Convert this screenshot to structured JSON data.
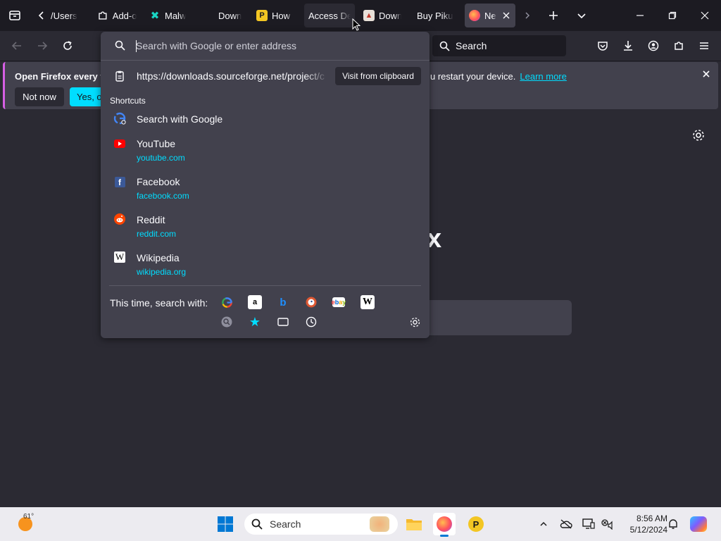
{
  "tabs": [
    {
      "label": "/Users",
      "icon": "chevron-left-icon"
    },
    {
      "label": "Add-o",
      "icon": "puzzle-icon"
    },
    {
      "label": "Malw",
      "icon": "malwarebytes-icon"
    },
    {
      "label": "Down",
      "icon": "none"
    },
    {
      "label": "How t",
      "icon": "plex-icon"
    },
    {
      "label": "Access De",
      "icon": "none"
    },
    {
      "label": "Down",
      "icon": "app-icon"
    },
    {
      "label": "Buy Pikun",
      "icon": "none"
    },
    {
      "label": "Ne",
      "icon": "firefox-icon"
    }
  ],
  "navbar": {
    "search_placeholder": "Search"
  },
  "notification": {
    "message": "Open Firefox every tir",
    "message_tail": "u restart your device.",
    "learn_more": "Learn more",
    "not_now": "Not now",
    "yes": "Yes, o"
  },
  "urlbar": {
    "placeholder": "Search with Google or enter address",
    "clipboard_url": "https://downloads.sourceforge.net/project/c",
    "clipboard_button": "Visit from clipboard",
    "shortcuts_label": "Shortcuts",
    "results": [
      {
        "title": "Search with Google",
        "url": "",
        "icon": "google-icon"
      },
      {
        "title": "YouTube",
        "url": "youtube.com",
        "icon": "youtube-icon"
      },
      {
        "title": "Facebook",
        "url": "facebook.com",
        "icon": "facebook-icon"
      },
      {
        "title": "Reddit",
        "url": "reddit.com",
        "icon": "reddit-icon"
      },
      {
        "title": "Wikipedia",
        "url": "wikipedia.org",
        "icon": "wikipedia-icon"
      }
    ],
    "oneoff_label": "This time, search with:",
    "oneoff_engines": [
      "google-icon",
      "amazon-icon",
      "bing-icon",
      "duckduckgo-icon",
      "ebay-icon",
      "wikipedia-icon"
    ],
    "oneoff_modes": [
      "search-history-icon",
      "bookmarks-star-icon",
      "tabs-icon",
      "history-clock-icon"
    ]
  },
  "page": {
    "partial_letter": "x"
  },
  "taskbar": {
    "weather_temp": "61°",
    "search_placeholder": "Search",
    "time": "8:56 AM",
    "date": "5/12/2024"
  },
  "colors": {
    "accent": "#00ddff",
    "notification_border": "#d65fe4",
    "panel": "#42414d",
    "toolbar": "#2b2a33",
    "tabstrip": "#1c1b22"
  }
}
